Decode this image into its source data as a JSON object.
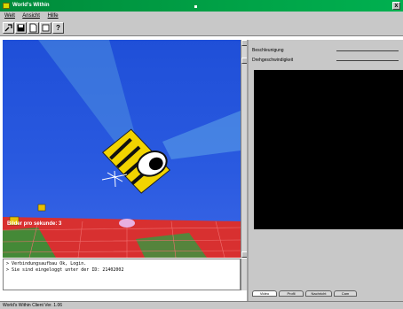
{
  "window": {
    "title": "World's Within",
    "close_glyph": "x"
  },
  "menubar": {
    "items": [
      "Welt",
      "Ansicht",
      "Hilfe"
    ]
  },
  "toolbar": {
    "buttons": [
      {
        "icon": "tools-icon"
      },
      {
        "icon": "save-icon"
      },
      {
        "icon": "document-icon"
      },
      {
        "icon": "new-icon"
      },
      {
        "icon": "help-icon",
        "glyph": "?"
      }
    ]
  },
  "viewport": {
    "fps_label": "Bilder pro sekunde: 3"
  },
  "console": {
    "lines": [
      "> Verbindungsaufbau Ok, Login.",
      "> Sie sind eingeloggt unter der ID: 21402002"
    ]
  },
  "right_panel": {
    "fields": [
      {
        "label": "Beschleunigung"
      },
      {
        "label": "Drehgeschwindigkeit"
      }
    ],
    "tabs": [
      "Video",
      "Profil",
      "Nachricht",
      "Cam"
    ],
    "active_tab": "Video"
  },
  "statusbar": {
    "text": "World's Within Client Ver. 1.06"
  },
  "colors": {
    "titlebar": "#00a347",
    "sky": "#1f4fd8",
    "floor": "#d83030",
    "video_bg": "#000000"
  }
}
